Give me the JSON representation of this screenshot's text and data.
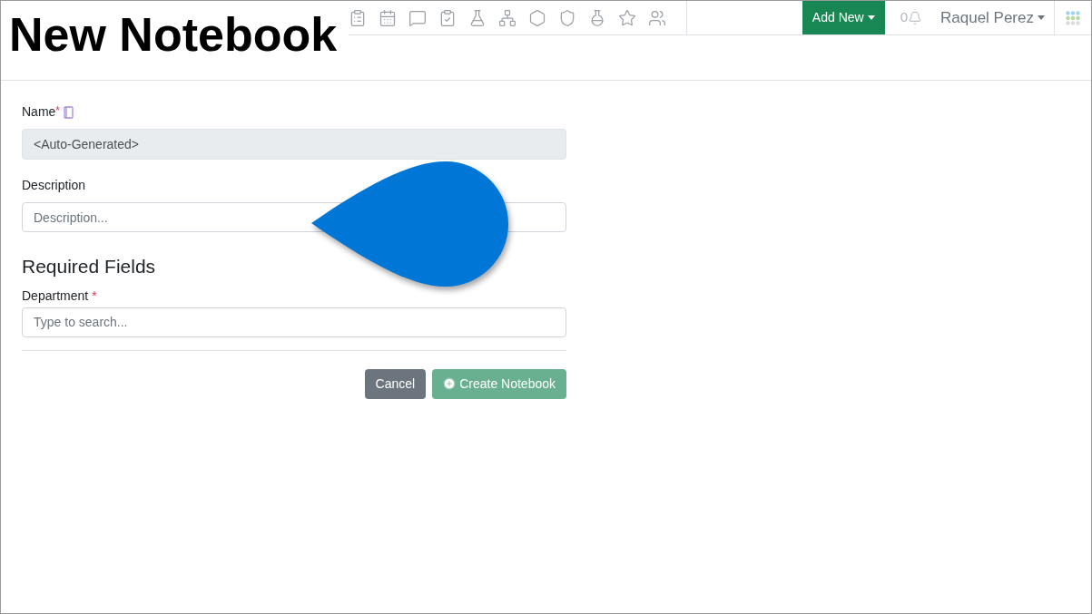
{
  "overlay_title": "New Notebook",
  "navbar": {
    "add_button": "Add New",
    "notification_count": "0",
    "user_name": "Raquel Perez"
  },
  "form": {
    "name_label": "Name",
    "name_required_mark": "*",
    "name_value": "<Auto-Generated>",
    "description_label": "Description",
    "description_placeholder": "Description...",
    "section_title": "Required Fields",
    "department_label": "Department",
    "department_required_mark": "*",
    "department_placeholder": "Type to search...",
    "buttons": [
      {
        "kind": "cancel",
        "label": "Cancel",
        "disabled": false
      },
      {
        "kind": "create",
        "label": "Create Notebook",
        "disabled": true
      }
    ]
  }
}
